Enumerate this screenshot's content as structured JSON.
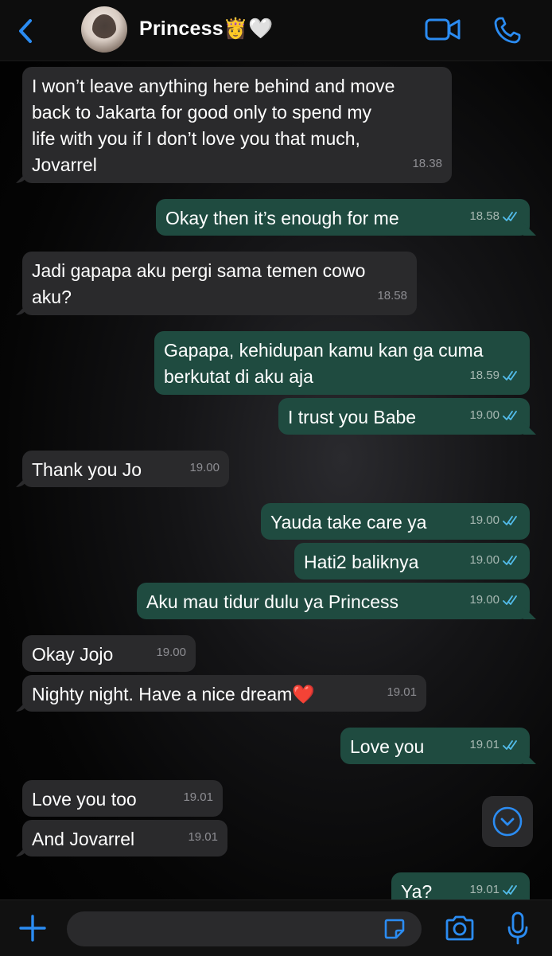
{
  "header": {
    "contact_name": "Princess👸🤍",
    "back_icon": "chevron-left-icon",
    "video_icon": "video-camera-icon",
    "phone_icon": "phone-icon"
  },
  "colors": {
    "accent": "#2b8cf2",
    "incoming_bubble": "#2a2a2c",
    "outgoing_bubble": "#1f4b40",
    "background": "#000000"
  },
  "messages": [
    {
      "dir": "in",
      "text": "I won’t leave anything here behind and move\nback to Jakarta for good only to spend my\nlife with you if I don’t love you that much,\nJovarrel",
      "time": "18.38"
    },
    {
      "dir": "out",
      "text": "Okay then it’s enough for me",
      "time": "18.58",
      "read": true
    },
    {
      "dir": "in",
      "text": "Jadi gapapa aku pergi sama temen cowo\naku?",
      "time": "18.58"
    },
    {
      "dir": "out",
      "text": "Gapapa, kehidupan kamu kan ga cuma\nberkutat di aku aja",
      "time": "18.59",
      "read": true
    },
    {
      "dir": "out",
      "text": "I trust you Babe",
      "time": "19.00",
      "read": true
    },
    {
      "dir": "in",
      "text": "Thank you Jo",
      "time": "19.00"
    },
    {
      "dir": "out",
      "text": "Yauda take care ya",
      "time": "19.00",
      "read": true
    },
    {
      "dir": "out",
      "text": "Hati2 baliknya",
      "time": "19.00",
      "read": true
    },
    {
      "dir": "out",
      "text": "Aku mau tidur dulu ya Princess",
      "time": "19.00",
      "read": true
    },
    {
      "dir": "in",
      "text": "Okay Jojo",
      "time": "19.00"
    },
    {
      "dir": "in",
      "text": "Nighty night. Have a nice dream❤️",
      "time": "19.01"
    },
    {
      "dir": "out",
      "text": "Love you",
      "time": "19.01",
      "read": true
    },
    {
      "dir": "in",
      "text": "Love you too",
      "time": "19.01"
    },
    {
      "dir": "in",
      "text": "And Jovarrel",
      "time": "19.01"
    },
    {
      "dir": "out",
      "text": "Ya?",
      "time": "19.01",
      "read": true
    }
  ],
  "scroll_button_icon": "chevron-down-circle-icon",
  "composer": {
    "placeholder": "",
    "plus_icon": "plus-icon",
    "sticker_icon": "sticker-icon",
    "camera_icon": "camera-icon",
    "mic_icon": "microphone-icon"
  }
}
